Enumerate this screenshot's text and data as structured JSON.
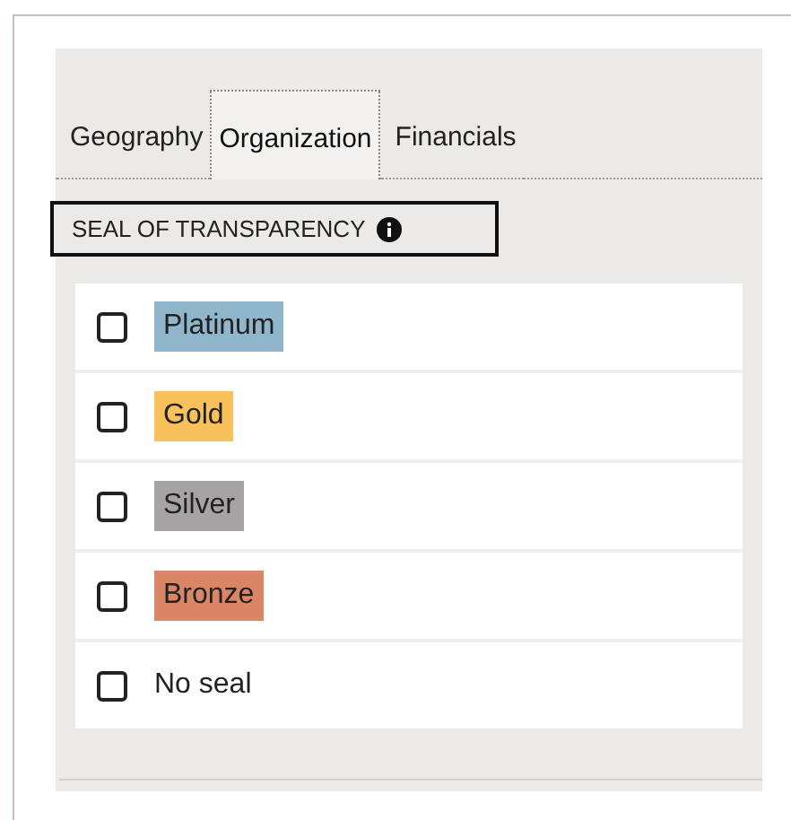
{
  "tabs": [
    {
      "label": "Geography",
      "selected": false
    },
    {
      "label": "Organization",
      "selected": true
    },
    {
      "label": "Financials",
      "selected": false
    }
  ],
  "section": {
    "title": "SEAL OF TRANSPARENCY"
  },
  "options": [
    {
      "label": "Platinum",
      "kind": "badge",
      "color": "#8fb6cb",
      "checked": false
    },
    {
      "label": "Gold",
      "kind": "badge",
      "color": "#f8c15c",
      "checked": false
    },
    {
      "label": "Silver",
      "kind": "badge",
      "color": "#a6a3a4",
      "checked": false
    },
    {
      "label": "Bronze",
      "kind": "badge",
      "color": "#d98566",
      "checked": false
    },
    {
      "label": "No seal",
      "kind": "plain",
      "checked": false
    }
  ]
}
